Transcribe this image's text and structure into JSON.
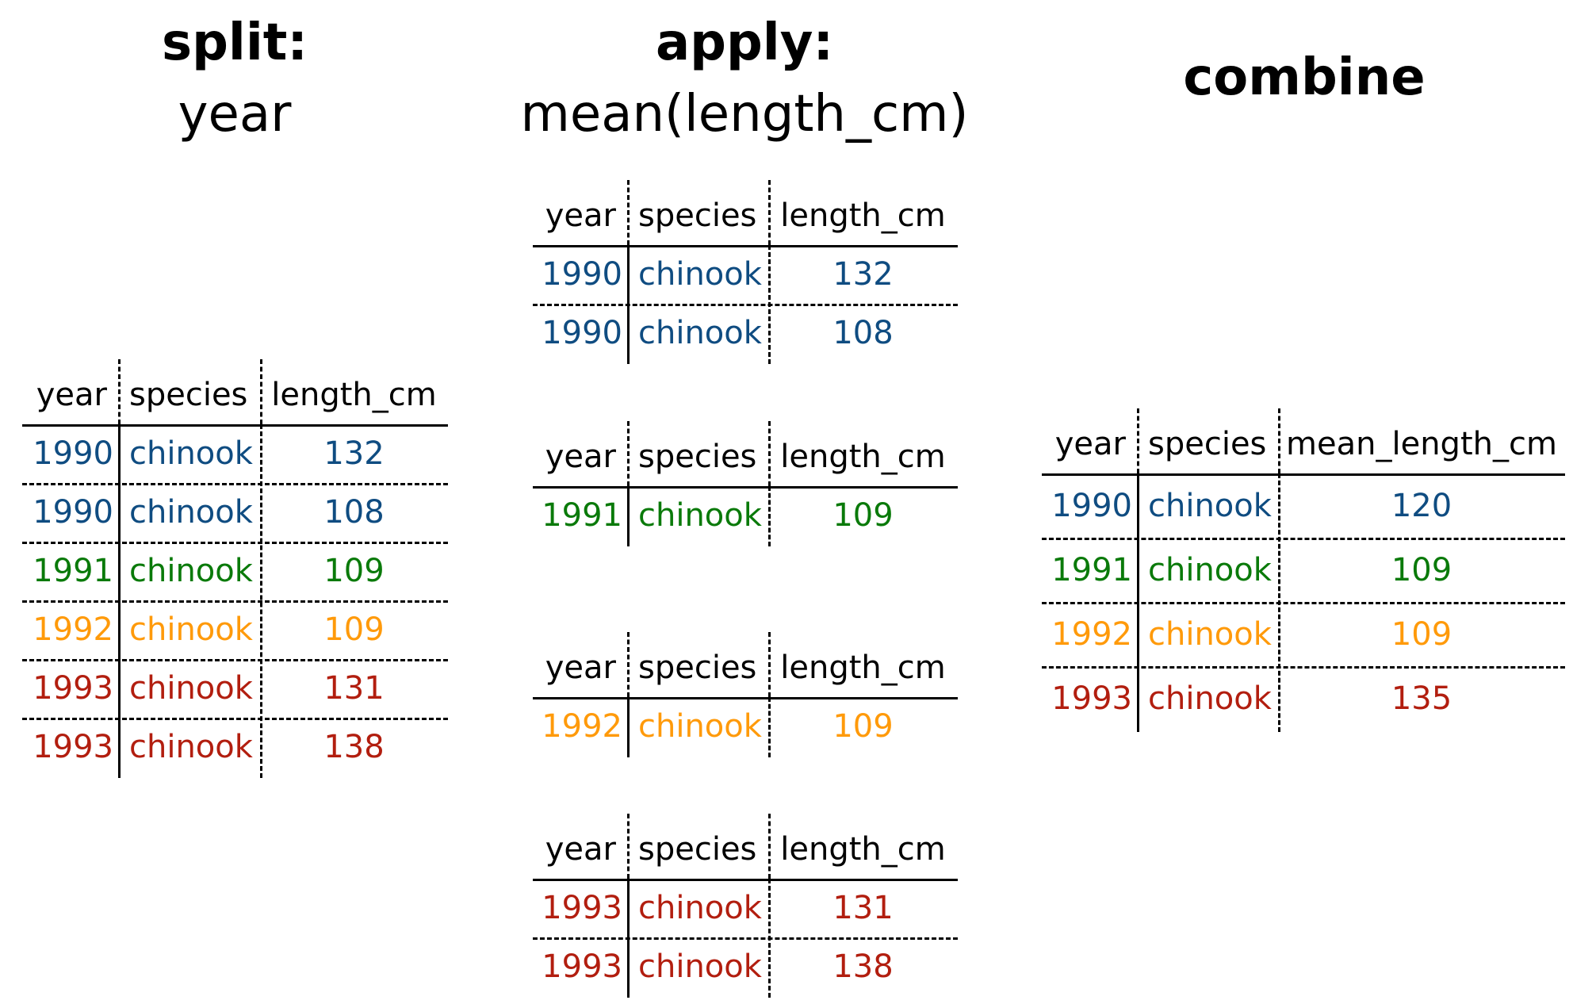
{
  "colors": {
    "1990": "#0F4C81",
    "1991": "#0A7A0A",
    "1992": "#FF9A0A",
    "1993": "#B21E0F"
  },
  "split": {
    "title": "split:",
    "subtitle": "year",
    "headers": [
      "year",
      "species",
      "length_cm"
    ],
    "rows": [
      [
        "1990",
        "chinook",
        "132"
      ],
      [
        "1990",
        "chinook",
        "108"
      ],
      [
        "1991",
        "chinook",
        "109"
      ],
      [
        "1992",
        "chinook",
        "109"
      ],
      [
        "1993",
        "chinook",
        "131"
      ],
      [
        "1993",
        "chinook",
        "138"
      ]
    ]
  },
  "apply": {
    "title": "apply:",
    "subtitle": "mean(length_cm)",
    "headers": [
      "year",
      "species",
      "length_cm"
    ],
    "groups": [
      [
        [
          "1990",
          "chinook",
          "132"
        ],
        [
          "1990",
          "chinook",
          "108"
        ]
      ],
      [
        [
          "1991",
          "chinook",
          "109"
        ]
      ],
      [
        [
          "1992",
          "chinook",
          "109"
        ]
      ],
      [
        [
          "1993",
          "chinook",
          "131"
        ],
        [
          "1993",
          "chinook",
          "138"
        ]
      ]
    ]
  },
  "combine": {
    "title": "combine",
    "headers": [
      "year",
      "species",
      "mean_length_cm"
    ],
    "rows": [
      [
        "1990",
        "chinook",
        "120"
      ],
      [
        "1991",
        "chinook",
        "109"
      ],
      [
        "1992",
        "chinook",
        "109"
      ],
      [
        "1993",
        "chinook",
        "135"
      ]
    ]
  }
}
